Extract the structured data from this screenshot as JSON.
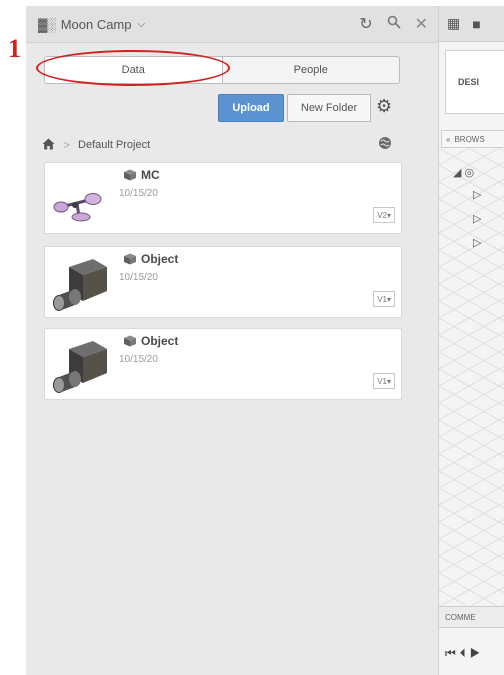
{
  "annotation": {
    "step_number": "1"
  },
  "header": {
    "team_icon": "people-icon",
    "project_name": "Moon Camp",
    "refresh_icon": "refresh-icon",
    "search_icon": "search-icon",
    "close_icon": "close-icon"
  },
  "tabs": [
    {
      "label": "Data",
      "active": true
    },
    {
      "label": "People",
      "active": false
    }
  ],
  "actions": {
    "upload_label": "Upload",
    "new_folder_label": "New Folder",
    "settings_icon": "gear-icon"
  },
  "breadcrumb": {
    "home_icon": "home-icon",
    "project_label": "Default Project",
    "globe_icon": "globe-icon"
  },
  "items": [
    {
      "name": "MC",
      "date": "10/15/20",
      "version": "V2▾"
    },
    {
      "name": "Object",
      "date": "10/15/20",
      "version": "V1▾"
    },
    {
      "name": "Object",
      "date": "10/15/20",
      "version": "V1▾"
    }
  ],
  "workspace": {
    "design_label": "DESI",
    "browser_label": "BROWS",
    "comments_label": "COMME",
    "colors": {
      "accent": "#5b93d2",
      "annotation": "#d32020"
    }
  }
}
